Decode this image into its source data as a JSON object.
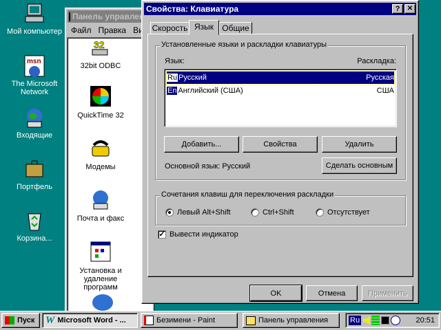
{
  "desktop": {
    "icons": [
      {
        "label": "Мой компьютер",
        "icon": "my-computer-icon"
      },
      {
        "label": "The Microsoft Network",
        "icon": "msn-icon"
      },
      {
        "label": "Входящие",
        "icon": "inbox-icon"
      },
      {
        "label": "Портфель",
        "icon": "briefcase-icon"
      },
      {
        "label": "Корзина...",
        "icon": "recycle-bin-icon"
      }
    ]
  },
  "control_panel": {
    "title": "Панель управления",
    "menu": [
      "Файл",
      "Правка",
      "Ви"
    ],
    "items": [
      "32bit ODBC",
      "QuickTime 32",
      "Модемы",
      "Почта и факс",
      "Установка и удаление программ"
    ]
  },
  "dialog": {
    "title": "Свойства: Клавиатура",
    "help": "?",
    "close": "✕",
    "tabs": [
      "Скорость",
      "Язык",
      "Общие"
    ],
    "active_tab": "Язык",
    "installed_group": "Установленные языки и раскладки клавиатуры",
    "col_language": "Язык:",
    "col_layout": "Раскладка:",
    "languages": [
      {
        "code": "Ru",
        "name": "Русский",
        "layout": "Русская",
        "selected": true
      },
      {
        "code": "En",
        "name": "Английский (США)",
        "layout": "США",
        "selected": false
      }
    ],
    "add": "Добавить...",
    "properties": "Свойства",
    "remove": "Удалить",
    "default_label": "Основной язык:",
    "default_value": "Русский",
    "set_default": "Сделать основным",
    "switch_group": "Сочетания клавиш для переключения раскладки",
    "switch_options": [
      "Левый Alt+Shift",
      "Ctrl+Shift",
      "Отсутствует"
    ],
    "switch_selected": 0,
    "indicator_label": "Вывести индикатор",
    "indicator_checked": true,
    "ok": "OK",
    "cancel": "Отмена",
    "apply": "Применить"
  },
  "taskbar": {
    "start": "Пуск",
    "tasks": [
      "Microsoft Word - ...",
      "Безимени - Paint",
      "Панель управления"
    ],
    "lang": "Ru",
    "clock": "20:51"
  }
}
